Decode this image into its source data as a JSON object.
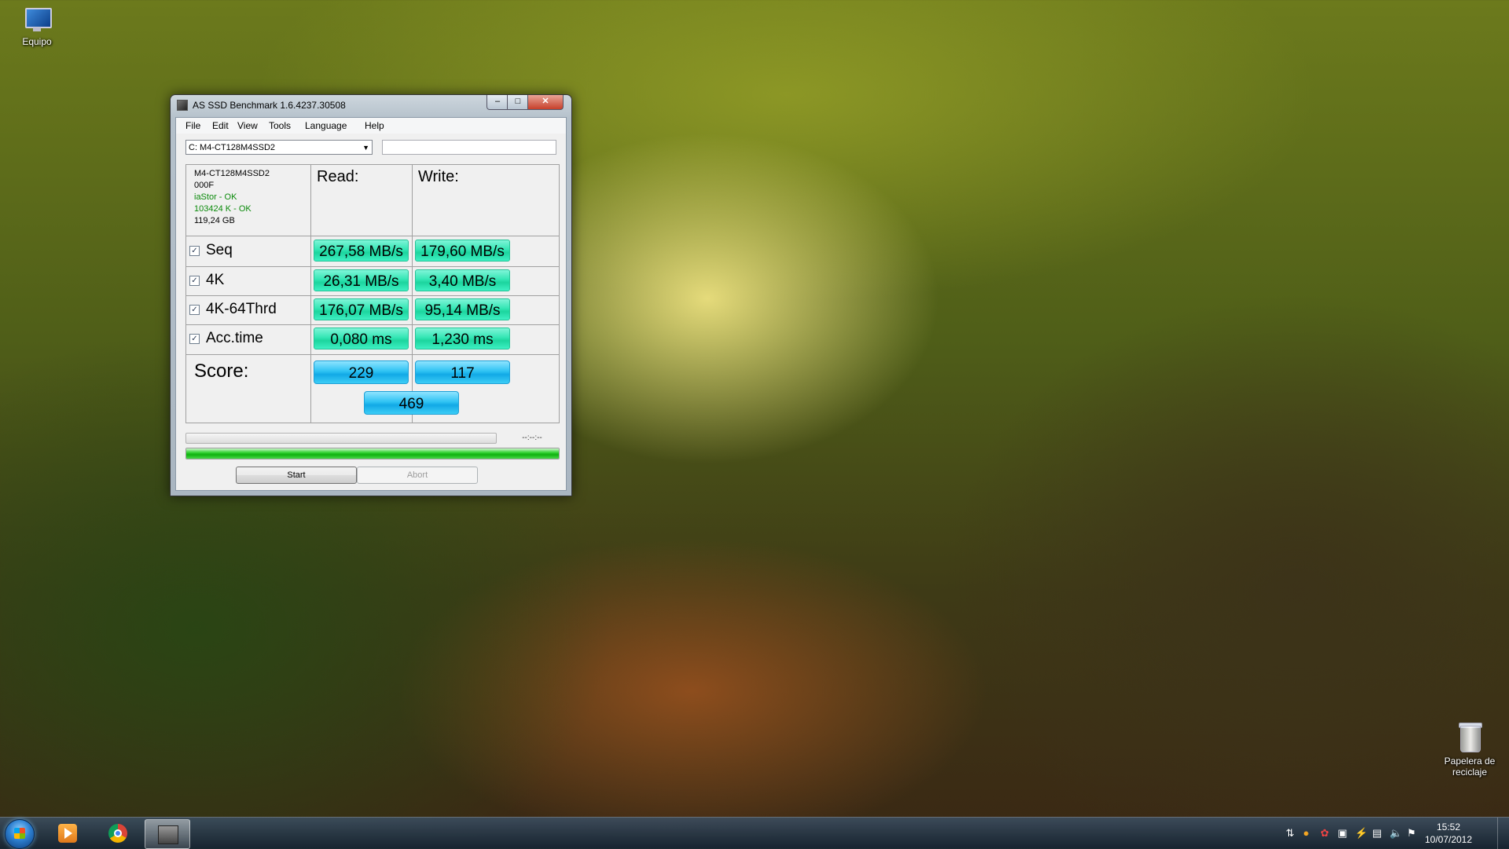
{
  "desktop": {
    "computer_label": "Equipo",
    "recycle_label": "Papelera de reciclaje"
  },
  "window": {
    "title": "AS SSD Benchmark 1.6.4237.30508",
    "controls": {
      "minimize": "–",
      "maximize": "□",
      "close": "✕"
    },
    "menu": [
      "File",
      "Edit",
      "View",
      "Tools",
      "Language",
      "Help"
    ],
    "drive_select": "C: M4-CT128M4SSD2",
    "drive_info": {
      "model": "M4-CT128M4SSD2",
      "firmware": "000F",
      "driver_status": "iaStor - OK",
      "alignment_status": "103424 K - OK",
      "size": "119,24 GB"
    },
    "headers": {
      "read": "Read:",
      "write": "Write:"
    },
    "rows": [
      {
        "label": "Seq",
        "checked": true,
        "read": "267,58 MB/s",
        "write": "179,60 MB/s"
      },
      {
        "label": "4K",
        "checked": true,
        "read": "26,31 MB/s",
        "write": "3,40 MB/s"
      },
      {
        "label": "4K-64Thrd",
        "checked": true,
        "read": "176,07 MB/s",
        "write": "95,14 MB/s"
      },
      {
        "label": "Acc.time",
        "checked": true,
        "read": "0,080 ms",
        "write": "1,230 ms"
      }
    ],
    "score": {
      "label": "Score:",
      "read": "229",
      "write": "117",
      "total": "469"
    },
    "elapsed_time": "--:--:--",
    "progress_fraction": 1.0,
    "buttons": {
      "start": "Start",
      "abort": "Abort"
    },
    "check_mark": "✓"
  },
  "taskbar": {
    "clock_time": "15:52",
    "clock_date": "10/07/2012"
  },
  "colors": {
    "result_green": "#34e6b4",
    "score_blue": "#2fc3f3",
    "progress_green": "#10b210"
  }
}
